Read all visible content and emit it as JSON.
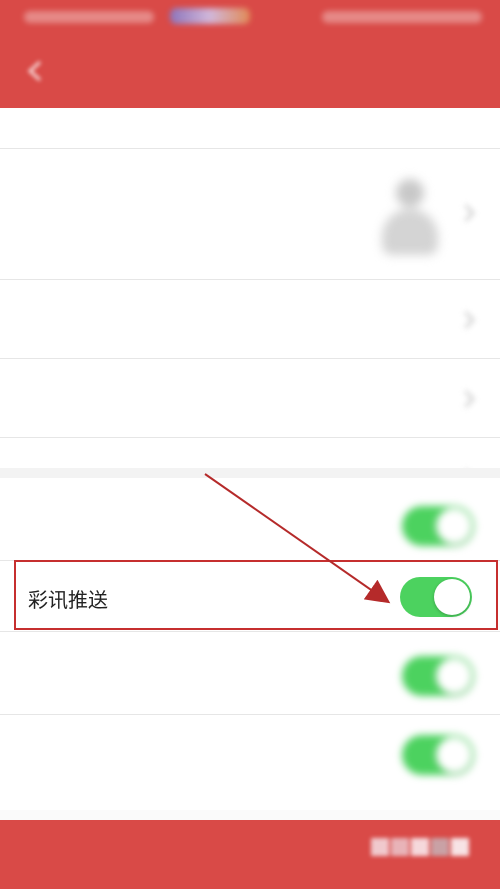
{
  "status_bar": {
    "left_text": "",
    "center_text": "",
    "right_text": ""
  },
  "header": {
    "back_icon": "back-arrow-icon",
    "title": ""
  },
  "rows": [
    {
      "label": "",
      "value": ""
    },
    {
      "label": "",
      "value": ""
    },
    {
      "label": "",
      "value": ""
    },
    {
      "label": "",
      "value": ""
    }
  ],
  "toggle_rows": [
    {
      "label": "",
      "on": true
    },
    {
      "label": "彩讯推送",
      "on": true,
      "highlighted": true
    },
    {
      "label": "",
      "on": true
    },
    {
      "label": "",
      "on": true
    }
  ],
  "footer": {
    "button_label": ""
  },
  "colors": {
    "header_red": "#d94a47",
    "toggle_green": "#4cd25f",
    "highlight_border": "#c62f2f",
    "arrow": "#b52a2a"
  }
}
